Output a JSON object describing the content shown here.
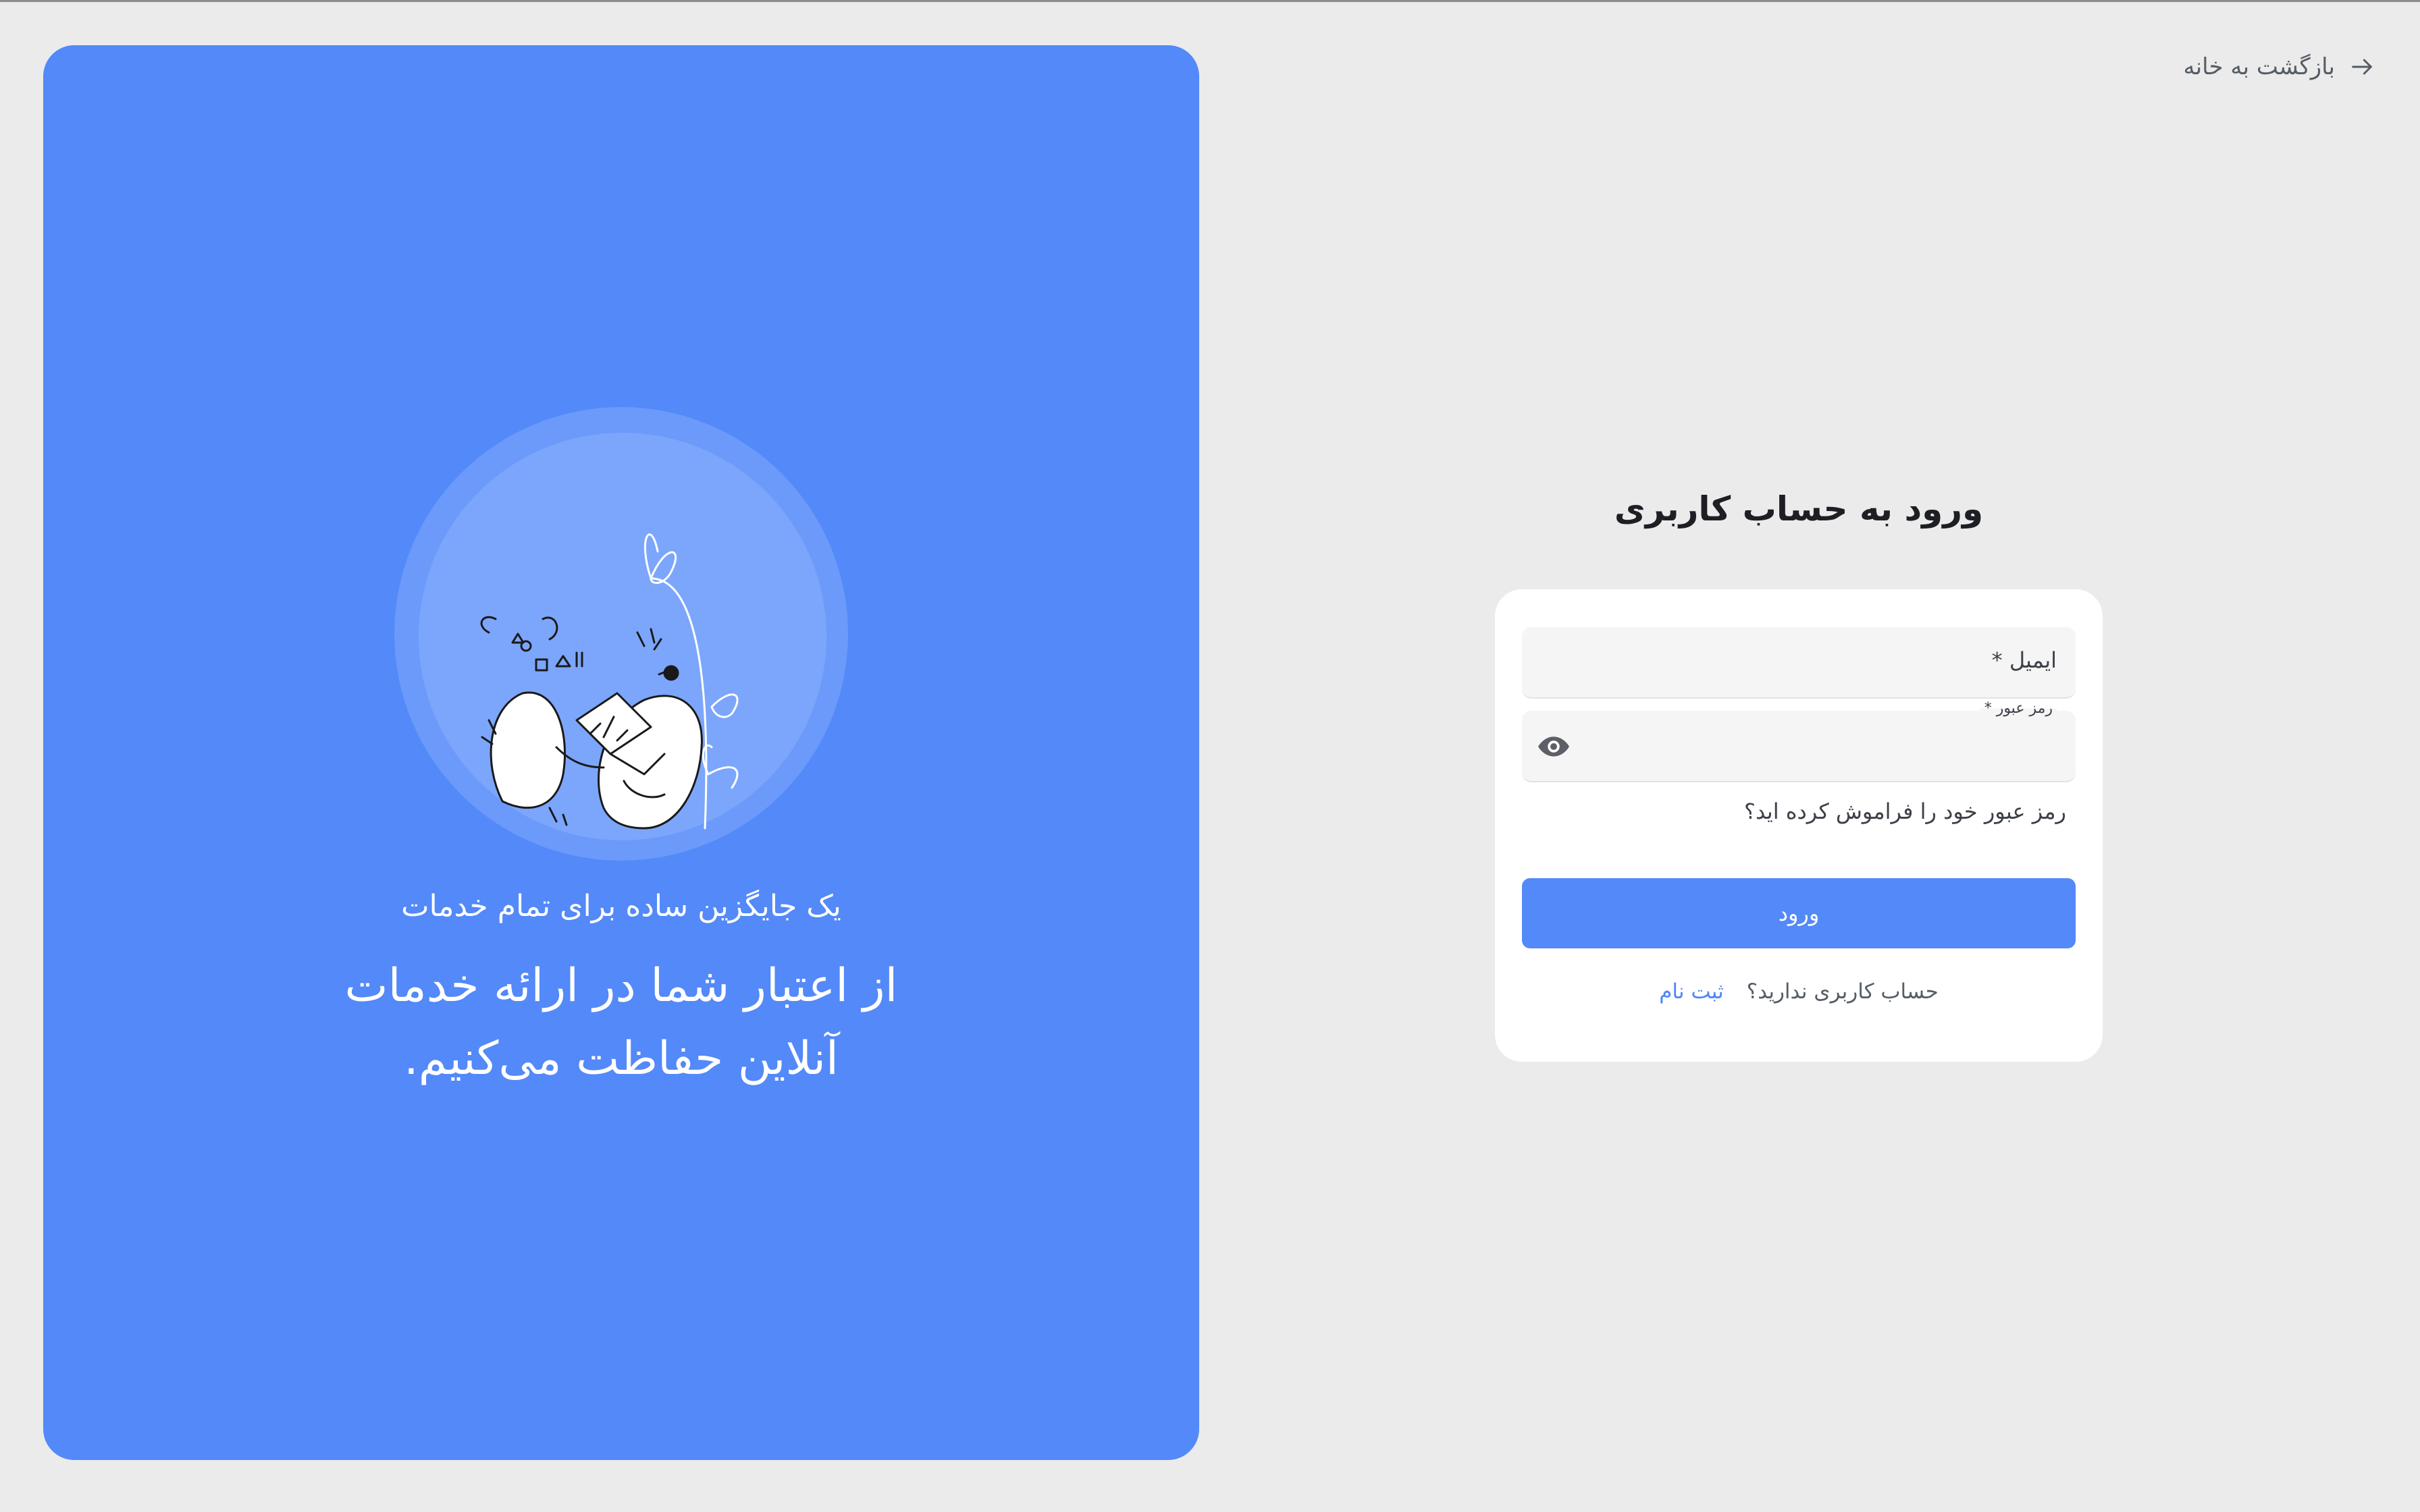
{
  "back": {
    "label": "بازگشت به خانه"
  },
  "hero": {
    "subtitle": "یک جایگزین ساده برای تمام خدمات",
    "title_line1": "از اعتبار شما در ارائه خدمات",
    "title_line2": "آنلاین حفاظت می‌کنیم."
  },
  "login": {
    "title": "ورود به حساب کاربری",
    "email_label": "ایمیل *",
    "password_label": "رمز عبور *",
    "forgot_label": "رمز عبور خود را فراموش کرده اید؟",
    "submit_label": "ورود",
    "no_account_text": "حساب کاربری ندارید؟",
    "signup_label": "ثبت نام"
  },
  "colors": {
    "brand": "#5389f8",
    "page_background": "#ebebeb",
    "link": "#4f86f6"
  },
  "icons": {
    "back": "arrow-right-icon",
    "password_toggle": "eye-icon"
  }
}
